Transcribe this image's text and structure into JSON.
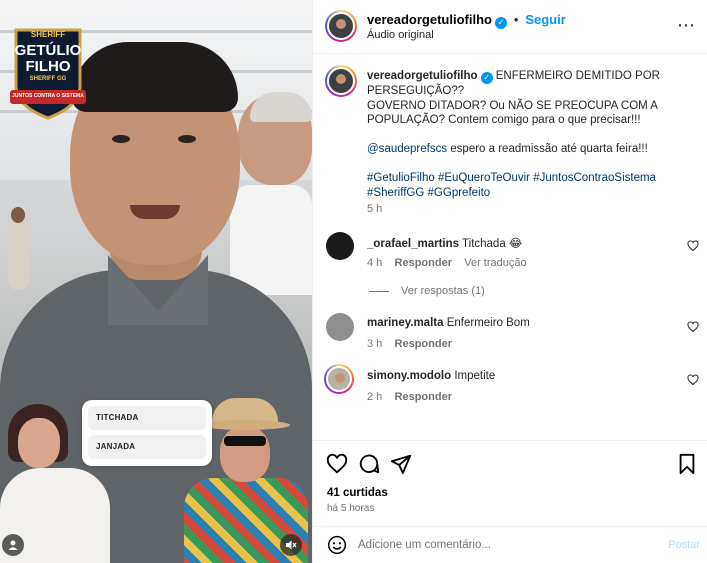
{
  "video": {
    "logo": {
      "top": "SHERIFF",
      "line1": "GETÚLIO",
      "line2": "FILHO",
      "badge": "SHERIFF GG",
      "slogan": "JUNTOS CONTRA O SISTEMA"
    },
    "poll_options": [
      "TITCHADA",
      "JANJADA"
    ]
  },
  "header": {
    "username": "vereadorgetuliofilho",
    "follow_separator": "•",
    "follow_label": "Seguir",
    "audio": "Áudio original"
  },
  "caption": {
    "username": "vereadorgetuliofilho",
    "text1": " ENFERMEIRO DEMITIDO POR PERSEGUIÇÃO??",
    "text2": "GOVERNO DITADOR? Ou NÃO SE PREOCUPA COM A POPULAÇÃO? Contem comigo para o que precisar!!!",
    "mention": "@saudeprefscs",
    "mention_text": " espero a readmissão até quarta feira!!!",
    "hashtags": [
      "#GetulioFilho",
      "#EuQueroTeOuvir",
      "#JuntosContraoSistema",
      "#SheriffGG",
      "#GGprefeito"
    ],
    "time": "5 h"
  },
  "comments": [
    {
      "username": "_orafael_martins",
      "text": "Titchada 😂",
      "time": "4 h",
      "reply": "Responder",
      "translate": "Ver tradução",
      "view_replies": "Ver respostas (1)"
    },
    {
      "username": "mariney.malta",
      "text": "Enfermeiro Bom",
      "time": "3 h",
      "reply": "Responder"
    },
    {
      "username": "simony.modolo",
      "text": "Impetite",
      "time": "2 h",
      "reply": "Responder"
    }
  ],
  "post": {
    "likes": "41 curtidas",
    "posted": "há 5 horas",
    "comment_placeholder": "Adicione um comentário...",
    "post_label": "Postar"
  },
  "colors": {
    "accent": "#0095f6",
    "link": "#00376b",
    "muted": "#737373"
  }
}
